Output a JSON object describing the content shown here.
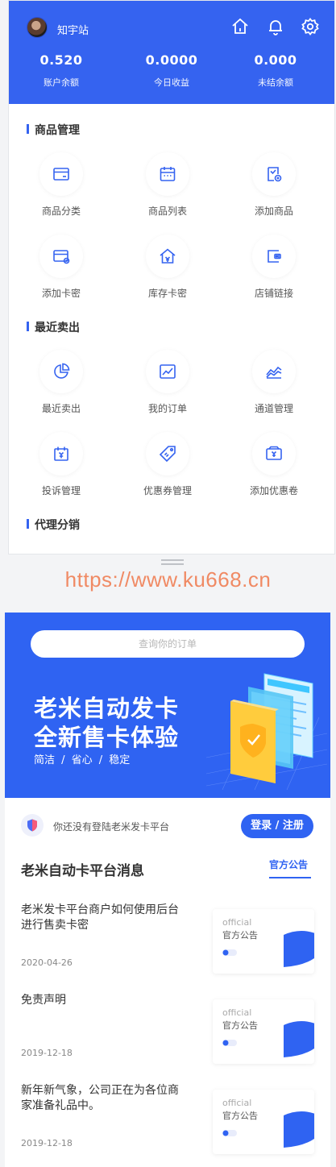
{
  "header": {
    "username": "知宇站",
    "stats": [
      {
        "value": "0.520",
        "label": "账户余额"
      },
      {
        "value": "0.0000",
        "label": "今日收益"
      },
      {
        "value": "0.000",
        "label": "未结余额"
      }
    ],
    "icons": [
      "home-icon",
      "bell-icon",
      "gear-icon"
    ]
  },
  "sections": [
    {
      "title": "商品管理",
      "items": [
        {
          "label": "商品分类",
          "icon": "category-card-icon"
        },
        {
          "label": "商品列表",
          "icon": "list-calendar-icon"
        },
        {
          "label": "添加商品",
          "icon": "add-product-icon"
        },
        {
          "label": "添加卡密",
          "icon": "add-card-key-icon"
        },
        {
          "label": "库存卡密",
          "icon": "stock-house-icon"
        },
        {
          "label": "店铺链接",
          "icon": "shop-link-icon"
        }
      ]
    },
    {
      "title": "最近卖出",
      "items": [
        {
          "label": "最近卖出",
          "icon": "pie-chart-icon"
        },
        {
          "label": "我的订单",
          "icon": "line-chart-icon"
        },
        {
          "label": "通道管理",
          "icon": "area-chart-icon"
        },
        {
          "label": "投诉管理",
          "icon": "complaint-icon"
        },
        {
          "label": "优惠券管理",
          "icon": "coupon-tag-icon"
        },
        {
          "label": "添加优惠卷",
          "icon": "add-coupon-icon"
        }
      ]
    },
    {
      "title": "代理分销",
      "items": []
    }
  ],
  "watermark": "https://www.ku668.cn",
  "home": {
    "search_placeholder": "查询你的订单",
    "banner_title_1": "老米自动发卡",
    "banner_title_2": "全新售卡体验",
    "banner_tags": "简洁  /  省心  /  稳定",
    "login_prompt": "你还没有登陆老米发卡平台",
    "login_button": "登录 / 注册",
    "messages_title": "老米自动卡平台消息",
    "tab_label": "官方公告",
    "news": [
      {
        "title": "老米发卡平台商户如何使用后台进行售卖卡密",
        "date": "2020-04-26",
        "card_en": "official",
        "card_cn": "官方公告"
      },
      {
        "title": "免责声明",
        "date": "2019-12-18",
        "card_en": "official",
        "card_cn": "官方公告"
      },
      {
        "title": "新年新气象，公司正在为各位商家准备礼品中。",
        "date": "2019-12-18",
        "card_en": "official",
        "card_cn": "官方公告"
      }
    ]
  },
  "colors": {
    "primary": "#3563f0",
    "watermark": "#f08a64"
  }
}
